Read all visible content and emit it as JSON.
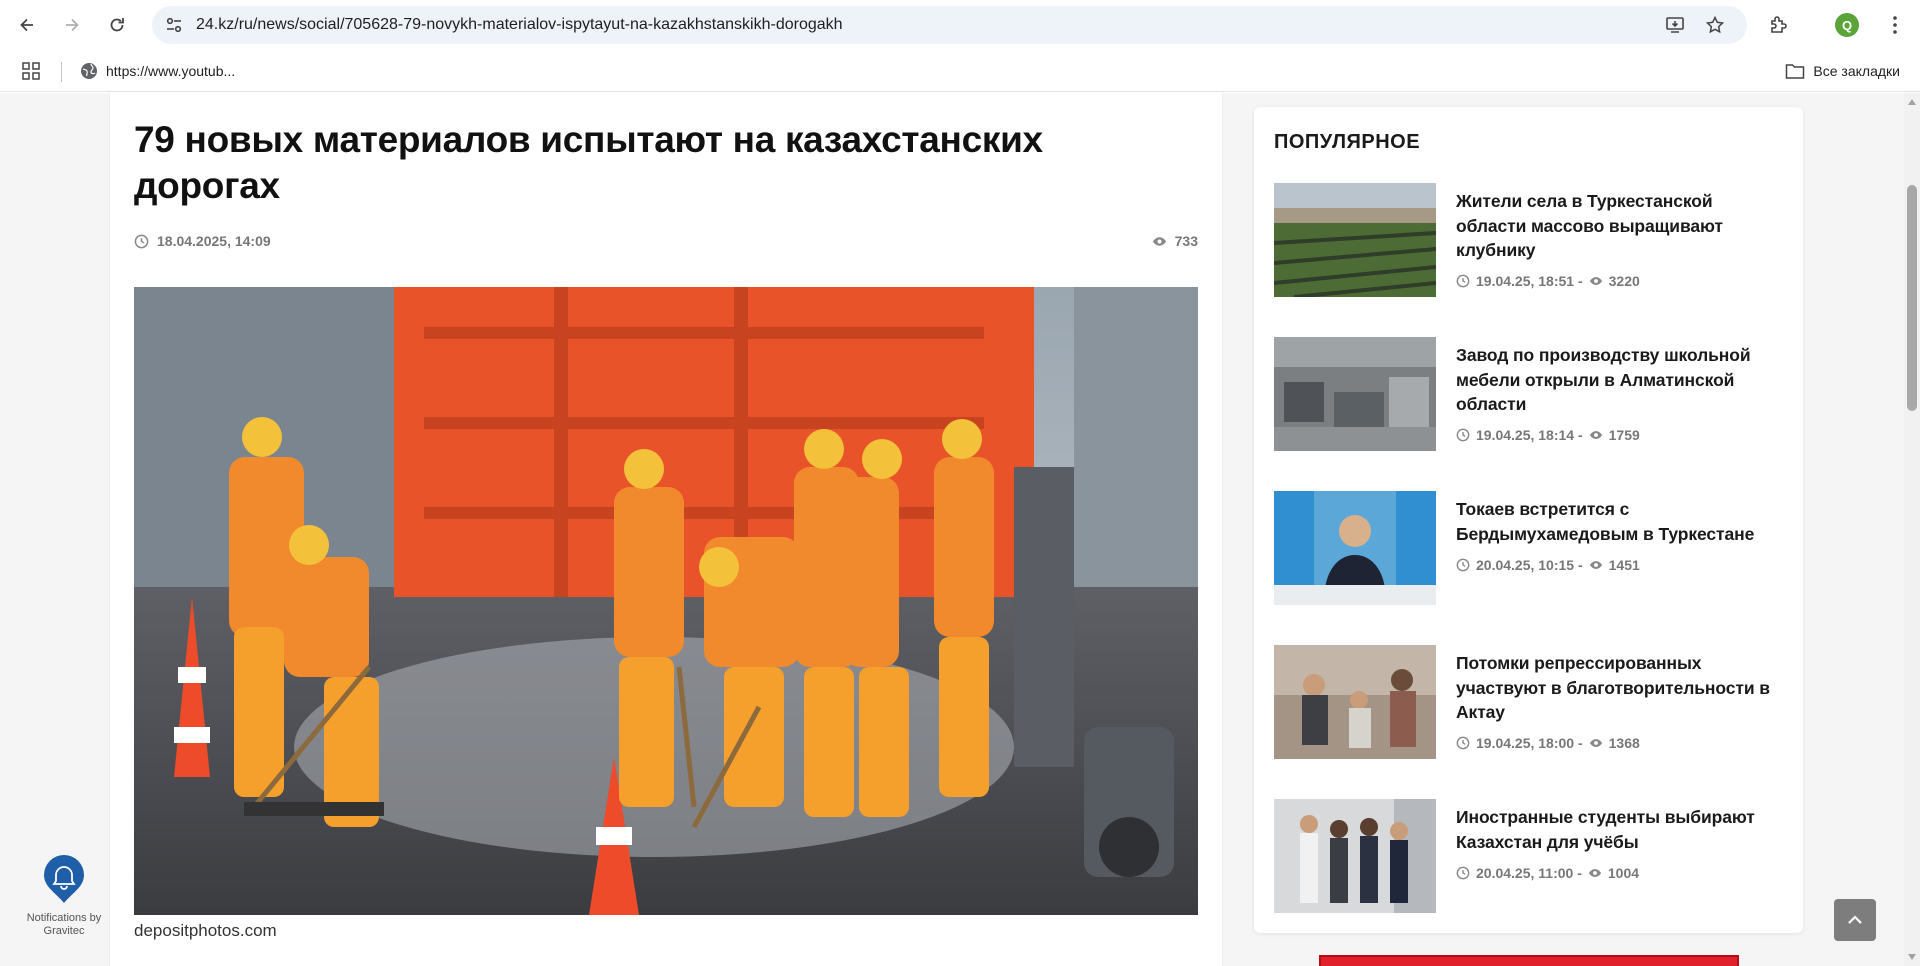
{
  "browser": {
    "url": "24.kz/ru/news/social/705628-79-novykh-materialov-ispytayut-na-kazakhstanskikh-dorogakh",
    "profile_initial": "Q",
    "bookmark": "https://www.youtub...",
    "all_bookmarks": "Все закладки"
  },
  "article": {
    "title": "79 новых материалов испытают на казахстанских дорогах",
    "date": "18.04.2025, 14:09",
    "views": "733",
    "photo_credit": "depositphotos.com"
  },
  "popular": {
    "heading": "ПОПУЛЯРНОЕ",
    "items": [
      {
        "title": "Жители села в Туркестанской области массово выращивают клубнику",
        "date": "19.04.25, 18:51 -",
        "views": "3220"
      },
      {
        "title": "Завод по производству школьной мебели открыли в Алматинской области",
        "date": "19.04.25, 18:14 -",
        "views": "1759"
      },
      {
        "title": "Токаев встретится с Бердымухамедовым в Туркестане",
        "date": "20.04.25, 10:15 -",
        "views": "1451"
      },
      {
        "title": "Потомки репрессированных участвуют в благотворительности в Актау",
        "date": "19.04.25, 18:00 -",
        "views": "1368"
      },
      {
        "title": "Иностранные студенты выбирают Казахстан для учёбы",
        "date": "20.04.25, 11:00 -",
        "views": "1004"
      }
    ]
  },
  "notifications": {
    "label": "Notifications by Gravitec"
  },
  "colors": {
    "accent_blue": "#1f5fa8",
    "ad_red": "#e0212b",
    "meta_gray": "#777777"
  }
}
